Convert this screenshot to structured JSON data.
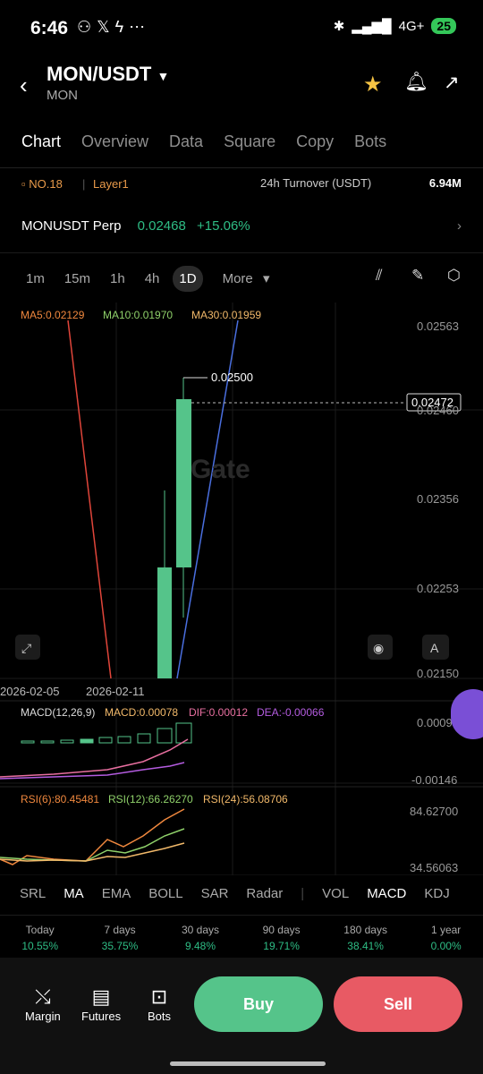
{
  "status": {
    "time": "6:46",
    "network": "4G+",
    "battery": "25"
  },
  "header": {
    "pair": "MON/USDT",
    "base": "MON"
  },
  "tabs": [
    "Chart",
    "Overview",
    "Data",
    "Square",
    "Copy",
    "Bots"
  ],
  "stats": {
    "rank": "NO.18",
    "tag": "Layer1",
    "turnover_label": "24h  Turnover (USDT)",
    "turnover_value": "6.94M"
  },
  "perp": {
    "name": "MONUSDT Perp",
    "price": "0.02468",
    "change": "+15.06%"
  },
  "timeframes": [
    "1m",
    "15m",
    "1h",
    "4h",
    "1D",
    "More"
  ],
  "ma": {
    "ma5": "MA5:0.02129",
    "ma10": "MA10:0.01970",
    "ma30": "MA30:0.01959"
  },
  "price_axis": [
    "0.02563",
    "0.02460",
    "0.02356",
    "0.02253",
    "0.02150"
  ],
  "current_price": "0.02472",
  "high_label": "0.02500",
  "date_labels": [
    "2026-02-05",
    "2026-02-11"
  ],
  "watermark": "Gate",
  "macd": {
    "title": "MACD(12,26,9)",
    "macd": "MACD:0.00078",
    "dif": "DIF:0.00012",
    "dea": "DEA:-0.00066",
    "top": "0.00097",
    "bottom": "-0.00146"
  },
  "rsi": {
    "rsi6": "RSI(6):80.45481",
    "rsi12": "RSI(12):66.26270",
    "rsi24": "RSI(24):56.08706",
    "top": "84.62700",
    "bottom": "34.56063"
  },
  "indicator_tabs": [
    "SRL",
    "MA",
    "EMA",
    "BOLL",
    "SAR",
    "Radar",
    "VOL",
    "MACD",
    "KDJ"
  ],
  "performance": [
    {
      "label": "Today",
      "value": "10.55%"
    },
    {
      "label": "7 days",
      "value": "35.75%"
    },
    {
      "label": "30 days",
      "value": "9.48%"
    },
    {
      "label": "90 days",
      "value": "19.71%"
    },
    {
      "label": "180 days",
      "value": "38.41%"
    },
    {
      "label": "1 year",
      "value": "0.00%"
    }
  ],
  "bottom_nav": {
    "margin": "Margin",
    "futures": "Futures",
    "bots": "Bots",
    "buy": "Buy",
    "sell": "Sell"
  },
  "colors": {
    "up": "#55c48a",
    "down": "#e85a64",
    "ma5": "#f0883e",
    "ma10": "#8fd16a",
    "ma30": "#f2b96a"
  }
}
